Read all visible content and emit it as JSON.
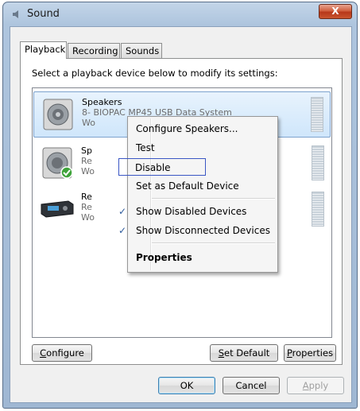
{
  "window": {
    "title": "Sound",
    "close_label": "X"
  },
  "tabs": [
    {
      "label": "Playback",
      "active": true
    },
    {
      "label": "Recording",
      "active": false
    },
    {
      "label": "Sounds",
      "active": false
    }
  ],
  "instruction": "Select a playback device below to modify its settings:",
  "devices": [
    {
      "name": "Speakers",
      "line1": "8- BIOPAC MP45 USB Data System",
      "line2": "Wo",
      "icon": "speaker-icon",
      "selected": true
    },
    {
      "name": "Sp",
      "line1": "Re",
      "line2": "Wo",
      "icon": "speaker-default-icon",
      "selected": false
    },
    {
      "name": "Re",
      "line1": "Re",
      "line2": "Wo",
      "icon": "receiver-icon",
      "selected": false
    }
  ],
  "context_menu": {
    "items": [
      {
        "label": "Configure Speakers...",
        "checked": false
      },
      {
        "label": "Test",
        "checked": false
      },
      {
        "label": "Disable",
        "checked": false,
        "highlighted": true
      },
      {
        "label": "Set as Default Device",
        "checked": false
      },
      {
        "label": "Show Disabled Devices",
        "checked": true
      },
      {
        "label": "Show Disconnected Devices",
        "checked": true
      },
      {
        "label": "Properties",
        "checked": false,
        "bold": true
      }
    ],
    "check_glyph": "✓"
  },
  "panel_buttons": {
    "configure_prefix": "C",
    "configure_rest": "onfigure",
    "set_default_prefix": "S",
    "set_default_rest": "et Default",
    "properties_prefix": "P",
    "properties_rest": "roperties"
  },
  "dialog_buttons": {
    "ok": "OK",
    "cancel": "Cancel",
    "apply_prefix": "A",
    "apply_rest": "pply"
  }
}
